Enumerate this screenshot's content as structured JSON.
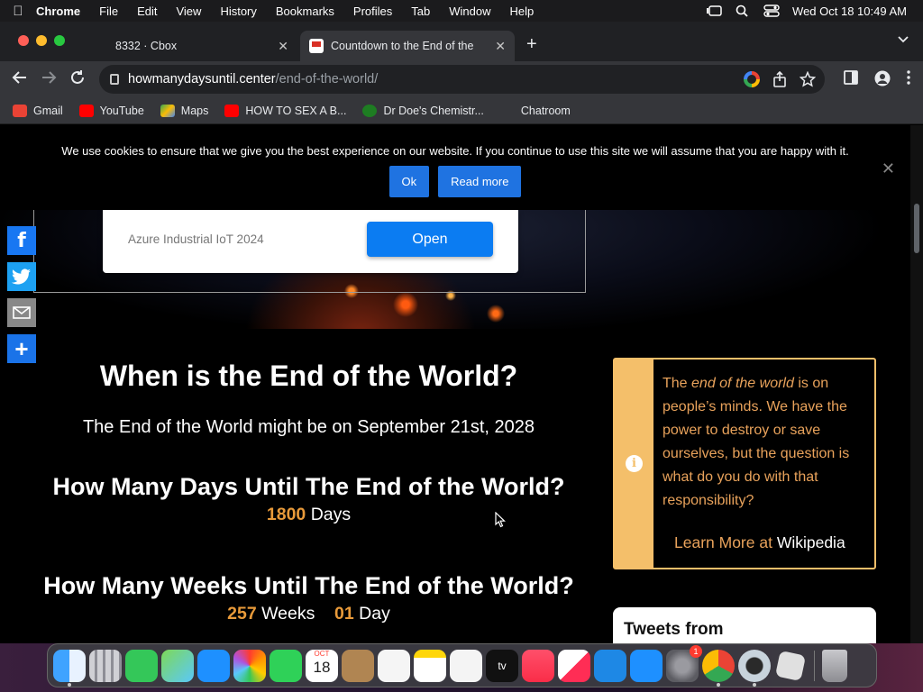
{
  "menubar": {
    "app": "Chrome",
    "items": [
      "File",
      "Edit",
      "View",
      "History",
      "Bookmarks",
      "Profiles",
      "Tab",
      "Window",
      "Help"
    ],
    "clock": "Wed Oct 18  10:49 AM"
  },
  "tabs": [
    {
      "title": "8332 · Cbox",
      "close": "✕"
    },
    {
      "title": "Countdown to the End of the W",
      "close": "✕"
    }
  ],
  "newtab": "+",
  "address": {
    "host": "howmanydaysuntil.center",
    "path": "/end-of-the-world/"
  },
  "bookmarks": [
    {
      "label": "Gmail",
      "color": "#ea4335"
    },
    {
      "label": "YouTube",
      "color": "#ff0000"
    },
    {
      "label": "Maps",
      "color": "#34a853"
    },
    {
      "label": "HOW TO SEX A B...",
      "color": "#ff0000"
    },
    {
      "label": "Dr Doe's Chemistr...",
      "color": "#1e7d22"
    },
    {
      "label": "Chatroom",
      "color": "#35363a"
    }
  ],
  "cookie": {
    "text": "We use cookies to ensure that we give you the best experience on our website. If you continue to use this site we will assume that you are happy with it.",
    "ok": "Ok",
    "read_more": "Read more",
    "close": "✕"
  },
  "ad": {
    "text": "Azure Industrial IoT 2024",
    "button": "Open"
  },
  "share": {
    "facebook": "f",
    "share": "+"
  },
  "main": {
    "title": "When is the End of the World?",
    "subtitle": "The End of the World might be on September 21st, 2028",
    "days_heading": "How Many Days Until The End of the World?",
    "days_value": "1800",
    "days_unit": "Days",
    "weeks_heading": "How Many Weeks Until The End of the World?",
    "weeks_value": "257",
    "weeks_unit": "Weeks",
    "weeks_extra_value": "01",
    "weeks_extra_unit": "Day"
  },
  "info": {
    "icon": "i",
    "pre": "The ",
    "emph": "end of the world",
    "post": " is on people’s minds. We have the power to destroy or save ourselves, but the question is what do you do with that responsibility?",
    "learn": "Learn More at ",
    "link": "Wikipedia"
  },
  "tweets": {
    "heading": "Tweets from"
  },
  "dock": {
    "calendar_month": "OCT",
    "calendar_day": "18",
    "settings_badge": "1",
    "tv_label": "tv",
    "apps": [
      "finder",
      "launchpad",
      "messages",
      "maps",
      "mail",
      "photos",
      "facetime",
      "calendar",
      "contacts",
      "reminders",
      "notes",
      "freeform",
      "tv",
      "music",
      "news",
      "keynote",
      "app-store",
      "system-settings",
      "chrome",
      "quicktime",
      "roblox",
      "trash"
    ]
  }
}
